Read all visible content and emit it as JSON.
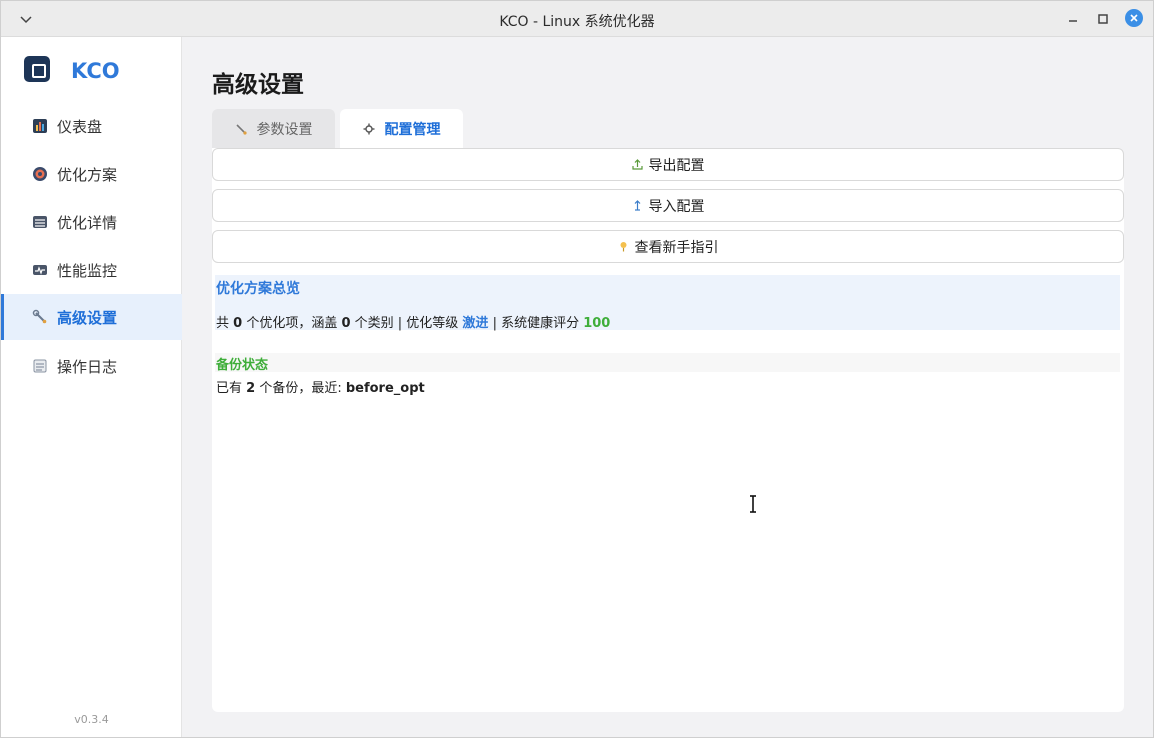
{
  "window": {
    "title": "KCO - Linux 系统优化器"
  },
  "sidebar": {
    "brand": "KCO",
    "items": [
      {
        "label": "仪表盘",
        "icon": "bar-chart-icon"
      },
      {
        "label": "优化方案",
        "icon": "target-icon"
      },
      {
        "label": "优化详情",
        "icon": "list-icon"
      },
      {
        "label": "性能监控",
        "icon": "pulse-icon"
      },
      {
        "label": "高级设置",
        "icon": "wrench-icon",
        "active": true
      },
      {
        "label": "操作日志",
        "icon": "log-icon"
      }
    ],
    "version": "v0.3.4"
  },
  "main": {
    "title": "高级设置",
    "tabs": [
      {
        "label": "参数设置",
        "icon": "wrench-icon"
      },
      {
        "label": "配置管理",
        "icon": "gear-icon",
        "active": true
      }
    ],
    "buttons": {
      "export": "导出配置",
      "import": "导入配置",
      "guide": "查看新手指引"
    },
    "overview": {
      "heading": "优化方案总览",
      "prefix": "共 ",
      "item_count": "0",
      "text1": " 个优化项，涵盖 ",
      "category_count": "0",
      "text2": " 个类别 | 优化等级 ",
      "level": "激进",
      "text3": " | 系统健康评分 ",
      "score": "100"
    },
    "backup": {
      "heading": "备份状态",
      "prefix": "已有 ",
      "count": "2",
      "text1": " 个备份，最近: ",
      "latest": "before_opt"
    }
  },
  "colors": {
    "accent": "#2f79d9",
    "success": "#3fae3a",
    "active_bg": "#e7f0fc"
  }
}
